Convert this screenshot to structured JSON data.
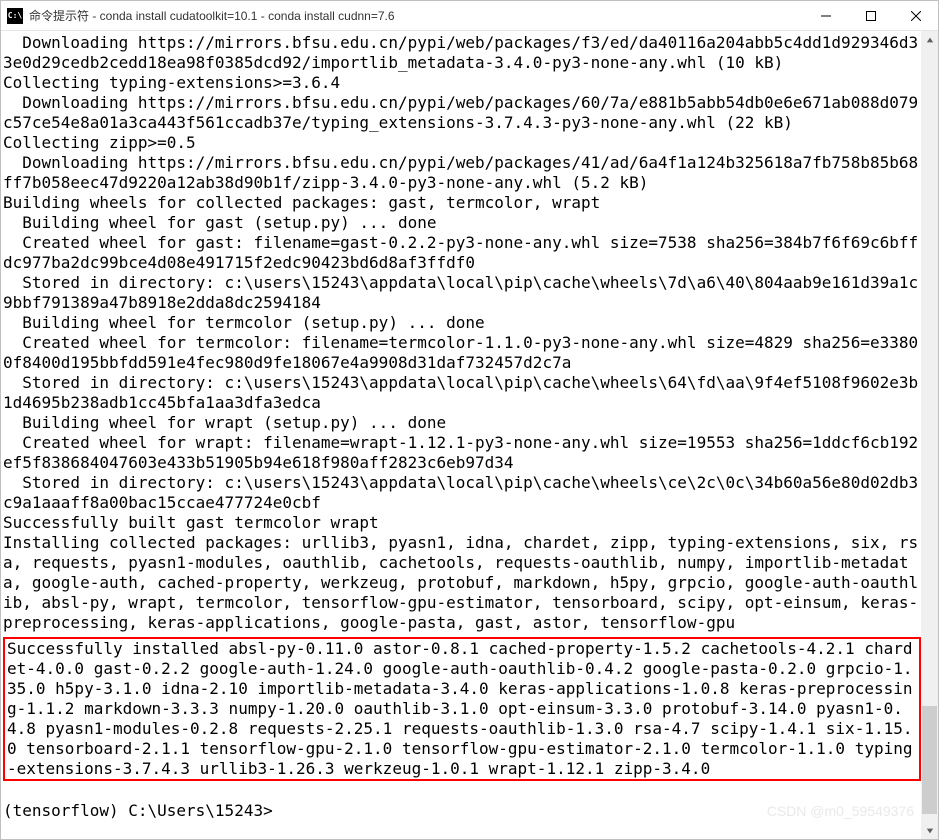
{
  "window": {
    "icon_text": "C:\\",
    "title": "命令提示符 - conda  install cudatoolkit=10.1 - conda  install cudnn=7.6"
  },
  "terminal": {
    "lines_top": "  Downloading https://mirrors.bfsu.edu.cn/pypi/web/packages/f3/ed/da40116a204abb5c4dd1d929346d33e0d29cedb2cedd18ea98f0385dcd92/importlib_metadata-3.4.0-py3-none-any.whl (10 kB)\nCollecting typing-extensions>=3.6.4\n  Downloading https://mirrors.bfsu.edu.cn/pypi/web/packages/60/7a/e881b5abb54db0e6e671ab088d079c57ce54e8a01a3ca443f561ccadb37e/typing_extensions-3.7.4.3-py3-none-any.whl (22 kB)\nCollecting zipp>=0.5\n  Downloading https://mirrors.bfsu.edu.cn/pypi/web/packages/41/ad/6a4f1a124b325618a7fb758b85b68ff7b058eec47d9220a12ab38d90b1f/zipp-3.4.0-py3-none-any.whl (5.2 kB)\nBuilding wheels for collected packages: gast, termcolor, wrapt\n  Building wheel for gast (setup.py) ... done\n  Created wheel for gast: filename=gast-0.2.2-py3-none-any.whl size=7538 sha256=384b7f6f69c6bffdc977ba2dc99bce4d08e491715f2edc90423bd6d8af3ffdf0\n  Stored in directory: c:\\users\\15243\\appdata\\local\\pip\\cache\\wheels\\7d\\a6\\40\\804aab9e161d39a1c9bbf791389a47b8918e2dda8dc2594184\n  Building wheel for termcolor (setup.py) ... done\n  Created wheel for termcolor: filename=termcolor-1.1.0-py3-none-any.whl size=4829 sha256=e33800f8400d195bbfdd591e4fec980d9fe18067e4a9908d31daf732457d2c7a\n  Stored in directory: c:\\users\\15243\\appdata\\local\\pip\\cache\\wheels\\64\\fd\\aa\\9f4ef5108f9602e3b1d4695b238adb1cc45bfa1aa3dfa3edca\n  Building wheel for wrapt (setup.py) ... done\n  Created wheel for wrapt: filename=wrapt-1.12.1-py3-none-any.whl size=19553 sha256=1ddcf6cb192ef5f838684047603e433b51905b94e618f980aff2823c6eb97d34\n  Stored in directory: c:\\users\\15243\\appdata\\local\\pip\\cache\\wheels\\ce\\2c\\0c\\34b60a56e80d02db3c9a1aaaff8a00bac15ccae477724e0cbf\nSuccessfully built gast termcolor wrapt\nInstalling collected packages: urllib3, pyasn1, idna, chardet, zipp, typing-extensions, six, rsa, requests, pyasn1-modules, oauthlib, cachetools, requests-oauthlib, numpy, importlib-metadata, google-auth, cached-property, werkzeug, protobuf, markdown, h5py, grpcio, google-auth-oauthlib, absl-py, wrapt, termcolor, tensorflow-gpu-estimator, tensorboard, scipy, opt-einsum, keras-preprocessing, keras-applications, google-pasta, gast, astor, tensorflow-gpu",
    "success_block": "Successfully installed absl-py-0.11.0 astor-0.8.1 cached-property-1.5.2 cachetools-4.2.1 chardet-4.0.0 gast-0.2.2 google-auth-1.24.0 google-auth-oauthlib-0.4.2 google-pasta-0.2.0 grpcio-1.35.0 h5py-3.1.0 idna-2.10 importlib-metadata-3.4.0 keras-applications-1.0.8 keras-preprocessing-1.1.2 markdown-3.3.3 numpy-1.20.0 oauthlib-3.1.0 opt-einsum-3.3.0 protobuf-3.14.0 pyasn1-0.4.8 pyasn1-modules-0.2.8 requests-2.25.1 requests-oauthlib-1.3.0 rsa-4.7 scipy-1.4.1 six-1.15.0 tensorboard-2.1.1 tensorflow-gpu-2.1.0 tensorflow-gpu-estimator-2.1.0 termcolor-1.1.0 typing-extensions-3.7.4.3 urllib3-1.26.3 werkzeug-1.0.1 wrapt-1.12.1 zipp-3.4.0",
    "prompt": "(tensorflow) C:\\Users\\15243>"
  },
  "watermark": "CSDN @m0_59549376"
}
